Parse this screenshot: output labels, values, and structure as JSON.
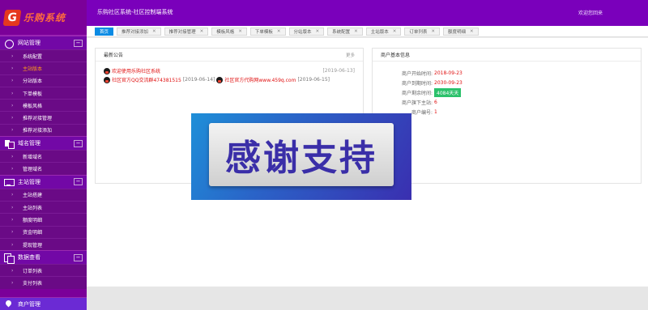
{
  "app": {
    "logo_mark": "G",
    "logo_text": "乐购系统",
    "header_title": "乐购社区系统-社区控制端系统",
    "header_right": "欢迎您回来"
  },
  "sidebar": {
    "groups": [
      {
        "label": "网站管理",
        "icon": "globe-icon",
        "toggle": "−",
        "items": [
          "系统配置",
          "主站版本",
          "分站版本",
          "下单模板",
          "模板风格",
          "推荐对接管理",
          "推荐对接添加"
        ],
        "current_index": 1
      },
      {
        "label": "域名管理",
        "icon": "domain-icon",
        "toggle": "−",
        "items": [
          "新增域名",
          "管理域名"
        ]
      },
      {
        "label": "主站管理",
        "icon": "monitor-icon",
        "toggle": "−",
        "items": [
          "主站搭建",
          "主站列表",
          "额度明细",
          "资金明细",
          "提现管理"
        ]
      },
      {
        "label": "数据查看",
        "icon": "copy-icon",
        "toggle": "−",
        "items": [
          "订单列表",
          "支付列表"
        ]
      }
    ],
    "bottom_group": {
      "label": "商户管理",
      "icon": "location-pin-icon"
    }
  },
  "tabs": [
    {
      "label": "首页",
      "closable": false
    },
    {
      "label": "推荐对接添加",
      "closable": true
    },
    {
      "label": "推荐对接管理",
      "closable": true
    },
    {
      "label": "模板风格",
      "closable": true
    },
    {
      "label": "下单模板",
      "closable": true
    },
    {
      "label": "分站版本",
      "closable": true
    },
    {
      "label": "系统配置",
      "closable": true
    },
    {
      "label": "主站版本",
      "closable": true
    },
    {
      "label": "订单列表",
      "closable": true
    },
    {
      "label": "额度明细",
      "closable": true
    }
  ],
  "tab_close_glyph": "✕",
  "notice": {
    "title": "最新公告",
    "more": "更多",
    "row1": {
      "text": "欢迎使用乐购社区系统",
      "date": "[2019-06-13]"
    },
    "row2": {
      "text_a": "社区官方QQ交流群474381515",
      "date_a": "[2019-06-14]",
      "text_b": "社区官方代购网www.459q.com",
      "date_b": "[2019-06-15]"
    }
  },
  "merchant": {
    "title": "商户基本信息",
    "rows": [
      {
        "label": "商户开始时间:",
        "value": "2018-09-23"
      },
      {
        "label": "商户到期时间:",
        "value": "2030-09-23"
      },
      {
        "label": "商户剩余时间:",
        "value": "4084天天",
        "badge": true
      },
      {
        "label": "商户旗下主站:",
        "value": "6"
      },
      {
        "label": "商户编号:",
        "value": "1"
      }
    ]
  },
  "overlay": {
    "text": "感谢支持"
  },
  "colors": {
    "sidebar": "#7b0099",
    "header": "#7a00bb",
    "tab_active": "#0b8be4",
    "current_item": "#ff9a1a",
    "value_red": "#e01010",
    "badge_green": "#2bc16b"
  }
}
